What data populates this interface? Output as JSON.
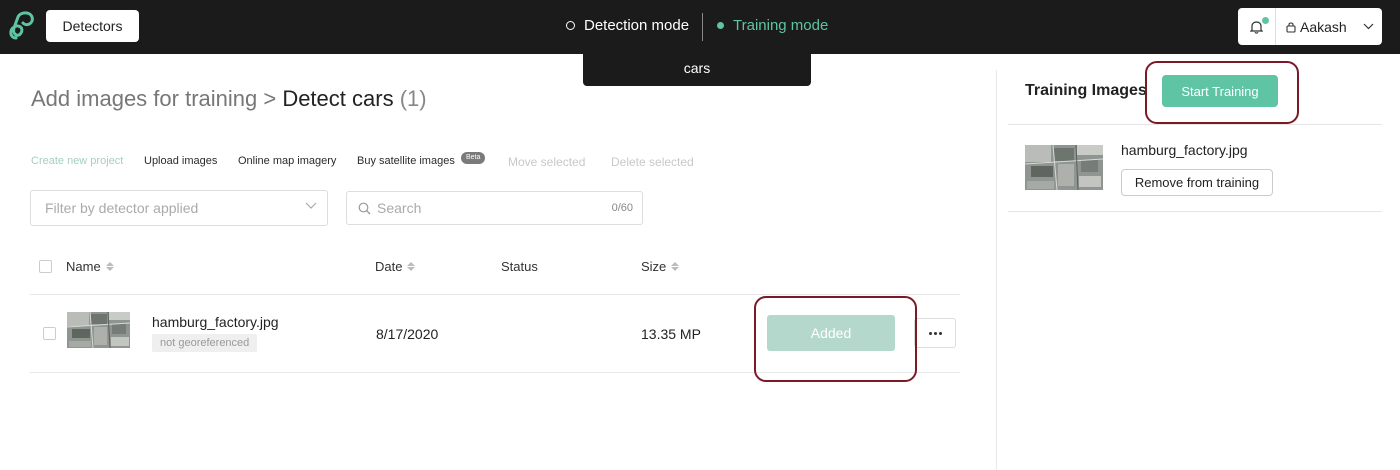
{
  "topbar": {
    "logo_icon": "looped-p-logo-icon",
    "detectors_label": "Detectors",
    "modes": [
      {
        "label": "Detection mode",
        "icon": "ring-icon",
        "active": false
      },
      {
        "label": "Training mode",
        "icon": "dot-icon",
        "active": true
      }
    ],
    "detector_tab": "cars",
    "user_name": "Aakash",
    "accent_color": "#5ec4a4",
    "bar_color": "#1b1b1b"
  },
  "main": {
    "title": {
      "prefix": "Add images for training",
      "separator": " > ",
      "detector": "Detect cars",
      "count": "(1)"
    },
    "actions": {
      "create": "Create new project",
      "upload": "Upload images",
      "online": "Online map imagery",
      "buy": "Buy satellite images",
      "beta": "Beta",
      "move": "Move selected",
      "delete": "Delete selected"
    },
    "filter_placeholder": "Filter by detector applied",
    "search": {
      "placeholder": "Search",
      "count": "0/60"
    },
    "table": {
      "headers": {
        "name": "Name",
        "date": "Date",
        "status": "Status",
        "size": "Size"
      },
      "rows": [
        {
          "name": "hamburg_factory.jpg",
          "tag": "not georeferenced",
          "date": "8/17/2020",
          "status": "",
          "size": "13.35 MP",
          "action": "Added"
        }
      ]
    }
  },
  "training_panel": {
    "title": "Training Images",
    "start_label": "Start Training",
    "items": [
      {
        "name": "hamburg_factory.jpg",
        "remove_label": "Remove from training"
      }
    ]
  },
  "highlight_color": "#7a1a28"
}
